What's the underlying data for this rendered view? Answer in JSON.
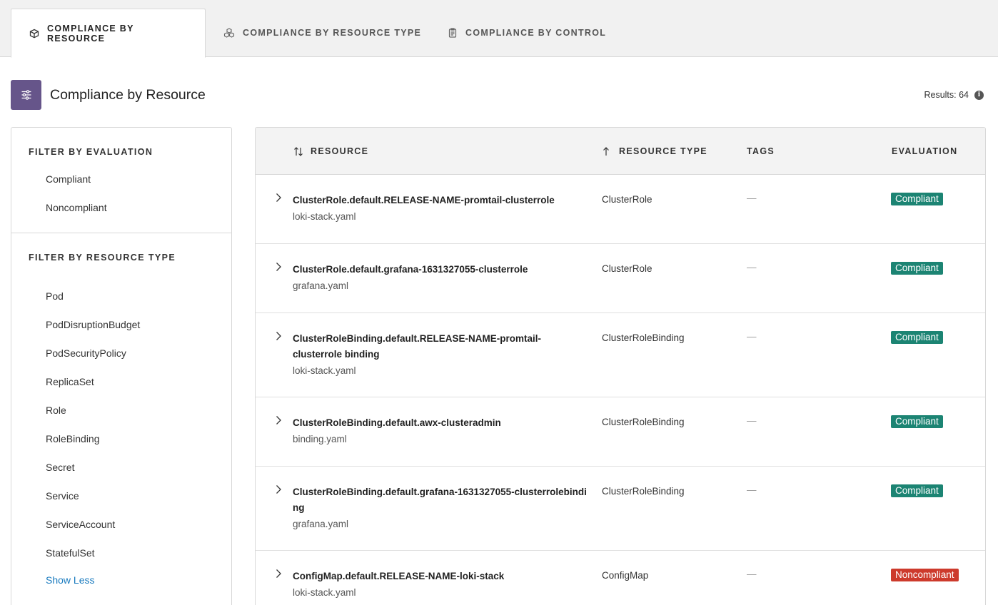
{
  "tabs": [
    {
      "label": "COMPLIANCE BY RESOURCE",
      "icon": "cube-icon",
      "active": true
    },
    {
      "label": "COMPLIANCE BY RESOURCE TYPE",
      "icon": "cubes-icon",
      "active": false
    },
    {
      "label": "COMPLIANCE BY CONTROL",
      "icon": "clipboard-icon",
      "active": false
    }
  ],
  "header": {
    "title": "Compliance by Resource",
    "icon": "sliders-icon",
    "results_label": "Results: 64",
    "accent_color": "#66558a"
  },
  "sidebar": {
    "evaluation_heading": "FILTER BY EVALUATION",
    "evaluation_items": [
      "Compliant",
      "Noncompliant"
    ],
    "resource_type_heading": "FILTER BY RESOURCE TYPE",
    "resource_type_items": [
      "Pod",
      "PodDisruptionBudget",
      "PodSecurityPolicy",
      "ReplicaSet",
      "Role",
      "RoleBinding",
      "Secret",
      "Service",
      "ServiceAccount",
      "StatefulSet"
    ],
    "show_less": "Show Less"
  },
  "table": {
    "columns": {
      "resource": "RESOURCE",
      "resource_type": "RESOURCE TYPE",
      "tags": "TAGS",
      "evaluation": "EVALUATION"
    },
    "rows": [
      {
        "name": "ClusterRole.default.RELEASE-NAME-promtail-clusterrole",
        "file": "loki-stack.yaml",
        "type": "ClusterRole",
        "tags": "—",
        "evaluation": "Compliant"
      },
      {
        "name": "ClusterRole.default.grafana-1631327055-clusterrole",
        "file": "grafana.yaml",
        "type": "ClusterRole",
        "tags": "—",
        "evaluation": "Compliant"
      },
      {
        "name": "ClusterRoleBinding.default.RELEASE-NAME-promtail-clusterrole binding",
        "file": "loki-stack.yaml",
        "type": "ClusterRoleBinding",
        "tags": "—",
        "evaluation": "Compliant"
      },
      {
        "name": "ClusterRoleBinding.default.awx-clusteradmin",
        "file": "binding.yaml",
        "type": "ClusterRoleBinding",
        "tags": "—",
        "evaluation": "Compliant"
      },
      {
        "name": "ClusterRoleBinding.default.grafana-1631327055-clusterrolebinding",
        "file": "grafana.yaml",
        "type": "ClusterRoleBinding",
        "tags": "—",
        "evaluation": "Compliant"
      },
      {
        "name": "ConfigMap.default.RELEASE-NAME-loki-stack",
        "file": "loki-stack.yaml",
        "type": "ConfigMap",
        "tags": "—",
        "evaluation": "Noncompliant"
      }
    ]
  },
  "colors": {
    "compliant": "#1c8473",
    "noncompliant": "#cd3a2c",
    "link": "#1a7bbf"
  }
}
